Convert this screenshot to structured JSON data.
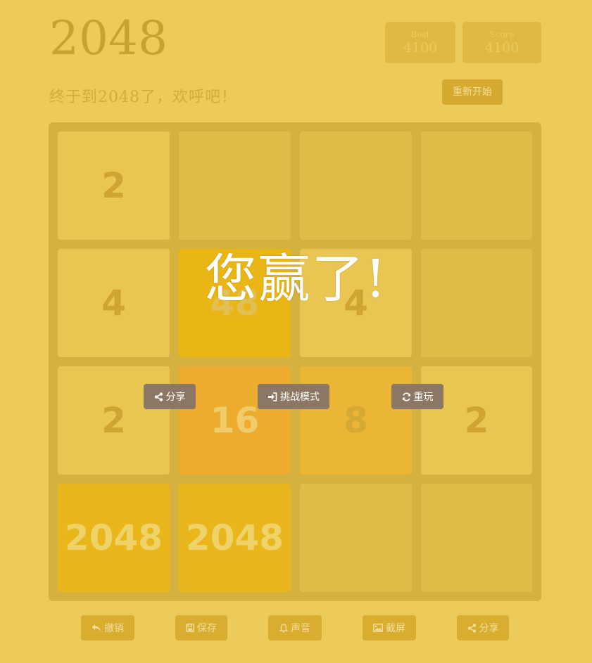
{
  "header": {
    "title": "2048",
    "best_label": "Best",
    "best_value": "4100",
    "score_label": "Score",
    "score_value": "4100",
    "subtitle": "终于到2048了，欢呼吧！",
    "restart_label": "重新开始"
  },
  "board": {
    "rows": [
      [
        "2",
        "",
        "",
        ""
      ],
      [
        "4",
        "48",
        "4",
        ""
      ],
      [
        "2",
        "16",
        "8",
        "2"
      ],
      [
        "2048",
        "2048",
        "",
        ""
      ]
    ]
  },
  "overlay": {
    "message": "您赢了!",
    "share_label": "分享",
    "challenge_label": "挑战模式",
    "replay_label": "重玩"
  },
  "toolbar": {
    "undo_label": "撤销",
    "save_label": "保存",
    "sound_label": "声音",
    "screenshot_label": "截屏",
    "share_label": "分享"
  },
  "colors": {
    "background": "#edcb5a",
    "board": "#d5b140",
    "overlay_button": "#8b7764"
  }
}
